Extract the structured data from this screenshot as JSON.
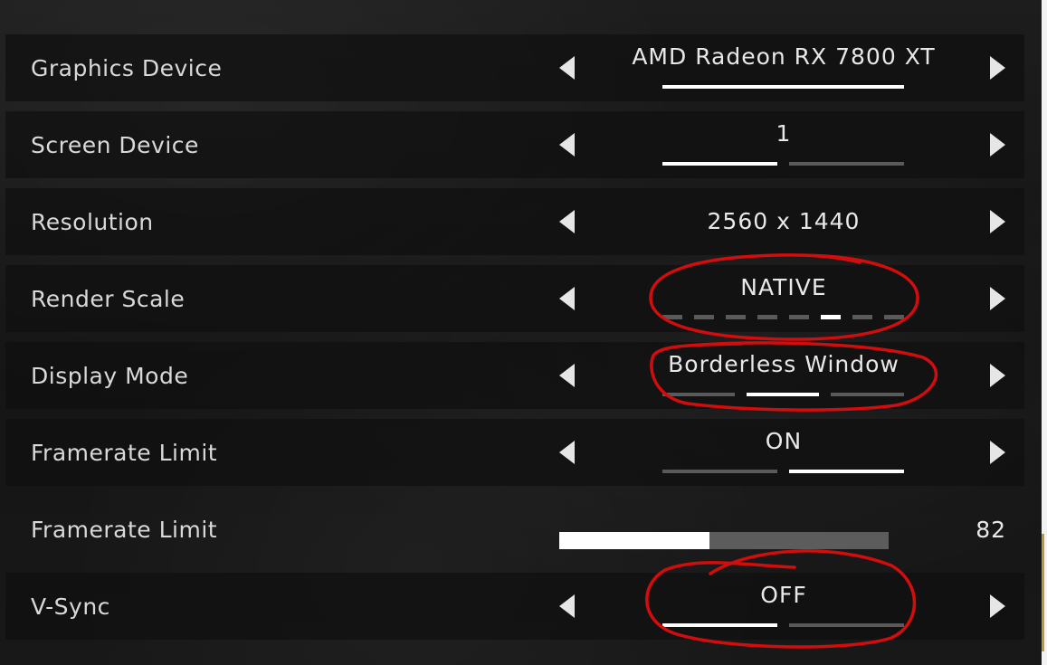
{
  "settings": [
    {
      "label": "Graphics Device",
      "value": "AMD Radeon RX 7800 XT",
      "segments": 1,
      "selected": 0
    },
    {
      "label": "Screen Device",
      "value": "1",
      "segments": 2,
      "selected": 0
    },
    {
      "label": "Resolution",
      "value": "2560 x 1440"
    },
    {
      "label": "Render Scale",
      "value": "NATIVE",
      "segments": 8,
      "selected": 5
    },
    {
      "label": "Display Mode",
      "value": "Borderless Window",
      "segments": 3,
      "selected": 1
    },
    {
      "label": "Framerate Limit",
      "value": "ON",
      "segments": 2,
      "selected": 1
    },
    {
      "label": "Framerate Limit",
      "slider_value": "82",
      "slider_fraction": 0.455
    },
    {
      "label": "V-Sync",
      "value": "OFF",
      "segments": 2,
      "selected": 0
    }
  ],
  "icons": {
    "prev": "chevron-left-icon",
    "next": "chevron-right-icon"
  },
  "colors": {
    "text": "#d9d9d9",
    "active_segment": "#ffffff",
    "inactive_segment": "#5a5a5a",
    "annotation": "#d10d0d"
  }
}
